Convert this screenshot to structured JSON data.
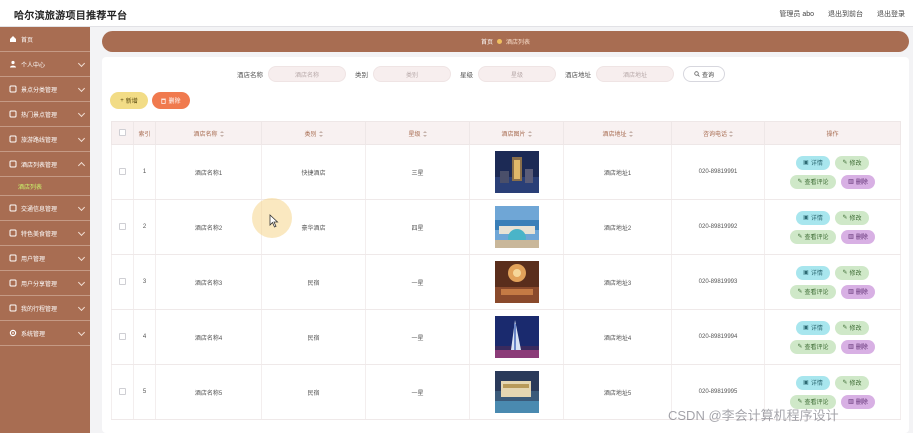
{
  "app": {
    "title": "哈尔滨旅游项目推荐平台",
    "user_label": "管理员 abo",
    "back_label": "退出到前台",
    "logout_label": "退出登录"
  },
  "sidebar": {
    "items": [
      {
        "label": "首页",
        "icon": "home-icon",
        "chevron": false
      },
      {
        "label": "个人中心",
        "icon": "user-icon",
        "chevron": true
      },
      {
        "label": "景点分类管理",
        "icon": "folder-icon",
        "chevron": true
      },
      {
        "label": "热门景点管理",
        "icon": "folder-icon",
        "chevron": true
      },
      {
        "label": "旅游路线管理",
        "icon": "folder-icon",
        "chevron": true
      },
      {
        "label": "酒店列表管理",
        "icon": "folder-icon",
        "chevron": true
      },
      {
        "label": "交通信息管理",
        "icon": "folder-icon",
        "chevron": true
      },
      {
        "label": "特色美食管理",
        "icon": "folder-icon",
        "chevron": true
      },
      {
        "label": "用户管理",
        "icon": "folder-icon",
        "chevron": true
      },
      {
        "label": "用户分享管理",
        "icon": "folder-icon",
        "chevron": true
      },
      {
        "label": "我的行程管理",
        "icon": "folder-icon",
        "chevron": true
      },
      {
        "label": "系统管理",
        "icon": "gear-icon",
        "chevron": true
      }
    ],
    "active_sub": "酒店列表"
  },
  "breadcrumb": {
    "home": "首页",
    "current": "酒店列表"
  },
  "filters": [
    {
      "label": "酒店名称",
      "placeholder": "酒店名称"
    },
    {
      "label": "类别",
      "placeholder": "类别"
    },
    {
      "label": "星级",
      "placeholder": "星级"
    },
    {
      "label": "酒店地址",
      "placeholder": "酒店地址"
    }
  ],
  "search_label": "查询",
  "add_label": "新增",
  "delete_label": "删除",
  "table": {
    "columns": [
      "索引",
      "酒店名称",
      "类别",
      "星级",
      "酒店图片",
      "酒店地址",
      "咨询电话",
      "操作"
    ],
    "rows": [
      {
        "index": "1",
        "name": "酒店名称1",
        "category": "快捷酒店",
        "star": "三星",
        "address": "酒店地址1",
        "phone": "020-89819991"
      },
      {
        "index": "2",
        "name": "酒店名称2",
        "category": "豪华酒店",
        "star": "四星",
        "address": "酒店地址2",
        "phone": "020-89819992"
      },
      {
        "index": "3",
        "name": "酒店名称3",
        "category": "民宿",
        "star": "一星",
        "address": "酒店地址3",
        "phone": "020-89819993"
      },
      {
        "index": "4",
        "name": "酒店名称4",
        "category": "民宿",
        "star": "一星",
        "address": "酒店地址4",
        "phone": "020-89819994"
      },
      {
        "index": "5",
        "name": "酒店名称5",
        "category": "民宿",
        "star": "一星",
        "address": "酒店地址5",
        "phone": "020-89819995"
      }
    ],
    "row_actions": {
      "detail": "详情",
      "edit": "修改",
      "review": "查看评论",
      "delete": "删除"
    }
  },
  "watermark": "CSDN @李会计算机程序设计",
  "colors": {
    "accent": "#a86d52",
    "add": "#f2dc86",
    "delete": "#f07a4e",
    "detail": "#a8e6ee",
    "edit": "#cfe8c8",
    "row_delete": "#d8b0e4"
  }
}
